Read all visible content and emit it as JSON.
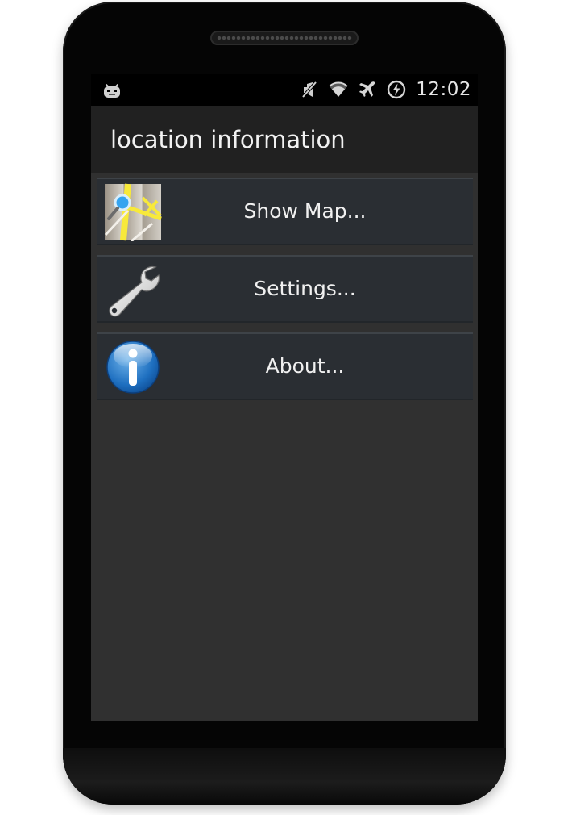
{
  "status_bar": {
    "time": "12:02",
    "icons": [
      "android-notification-icon",
      "mute-icon",
      "wifi-icon",
      "airplane-icon",
      "battery-charging-icon"
    ]
  },
  "app": {
    "title": "location information"
  },
  "menu": {
    "items": [
      {
        "label": "Show Map...",
        "icon": "map-icon"
      },
      {
        "label": "Settings...",
        "icon": "wrench-icon"
      },
      {
        "label": "About...",
        "icon": "info-icon"
      }
    ]
  },
  "colors": {
    "screen_bg": "#303030",
    "action_bar_bg": "#212121",
    "list_item_bg": "#2a2e33",
    "text": "#f0f0f0"
  }
}
